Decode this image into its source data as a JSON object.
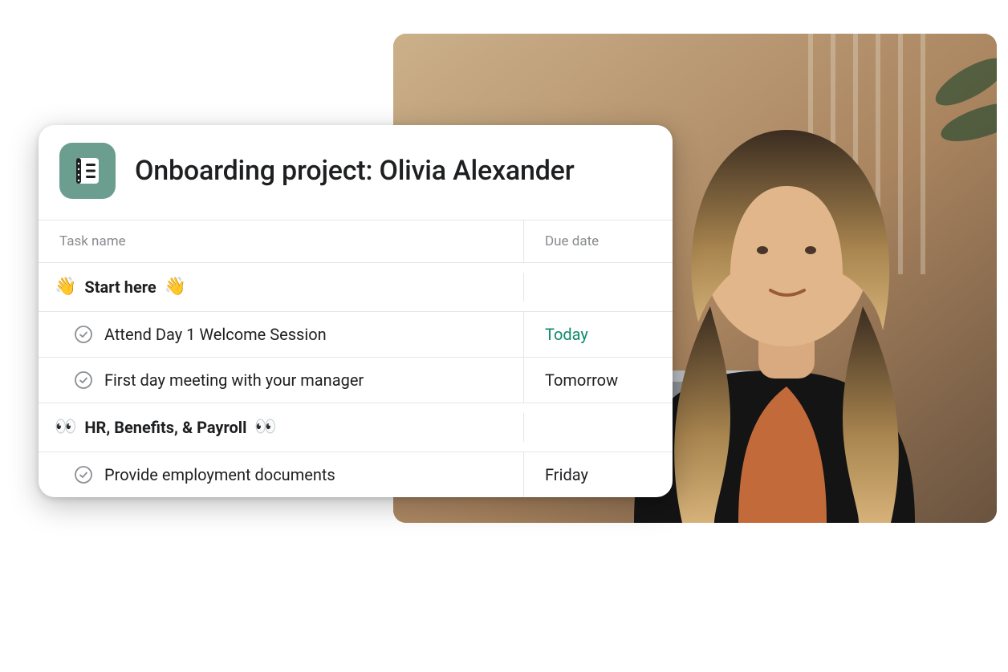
{
  "photo": {
    "alt": "Person working at a laptop in an office"
  },
  "project": {
    "title": "Onboarding project: Olivia Alexander",
    "icon_name": "notebook-list-icon",
    "columns": {
      "task": "Task name",
      "due": "Due date"
    },
    "sections": [
      {
        "title": "Start here",
        "emoji": "👋",
        "tasks": [
          {
            "name": "Attend Day 1 Welcome Session",
            "due": "Today",
            "due_style": "today"
          },
          {
            "name": "First day meeting with your manager",
            "due": "Tomorrow",
            "due_style": ""
          }
        ]
      },
      {
        "title": "HR, Benefits, & Payroll",
        "emoji": "👀",
        "tasks": [
          {
            "name": "Provide employment documents",
            "due": "Friday",
            "due_style": ""
          }
        ]
      }
    ]
  }
}
